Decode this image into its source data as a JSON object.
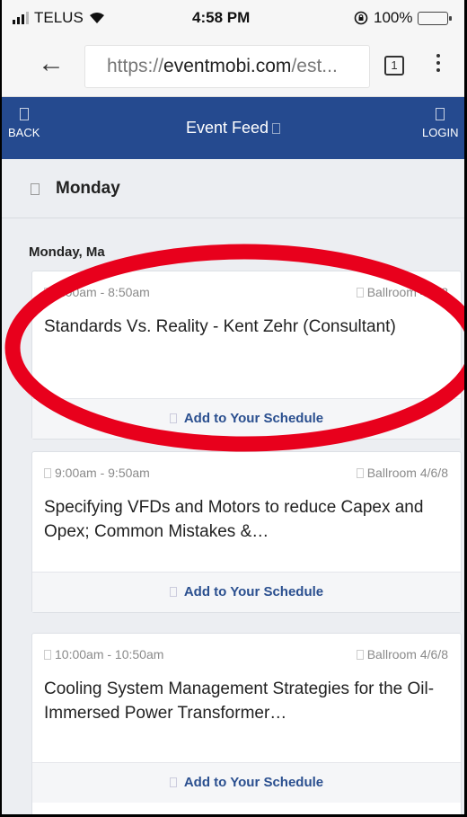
{
  "status_bar": {
    "carrier": "TELUS",
    "time": "4:58 PM",
    "battery": "100%"
  },
  "browser": {
    "url_prefix": "https://",
    "url_domain": "eventmobi.com",
    "url_rest": "/est...",
    "tab_count": "1"
  },
  "header": {
    "back_label": "BACK",
    "title": "Event Feed",
    "login_label": "LOGIN",
    "color": "#254a8f"
  },
  "day_filter": {
    "label": "Monday"
  },
  "feed": {
    "date_heading": "Monday, Ma",
    "sessions": [
      {
        "time": "8:00am - 8:50am",
        "location": "Ballroom 4/6/8",
        "title": "Standards Vs. Reality - Kent Zehr (Consultant)",
        "action": "Add to Your Schedule"
      },
      {
        "time": "9:00am - 9:50am",
        "location": "Ballroom 4/6/8",
        "title": "Specifying VFDs and Motors to reduce Capex and Opex; Common Mistakes &…",
        "action": "Add to Your Schedule"
      },
      {
        "time": "10:00am - 10:50am",
        "location": "Ballroom 4/6/8",
        "title": "Cooling System Management Strategies for the Oil-Immersed Power Transformer…",
        "action": "Add to Your Schedule"
      }
    ]
  },
  "annotation": {
    "shape": "ellipse",
    "color": "#e8001c"
  }
}
